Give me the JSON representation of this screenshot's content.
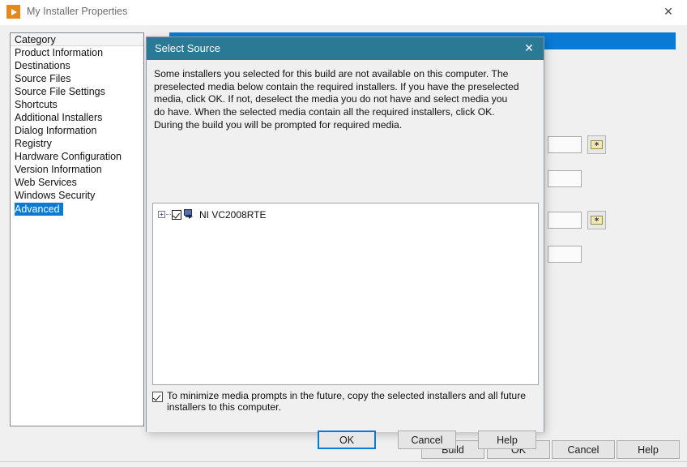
{
  "window": {
    "title": "My Installer Properties",
    "icon": "labview-play-icon",
    "close_label": "✕"
  },
  "sidebar": {
    "header": "Category",
    "items": [
      {
        "label": "Product Information",
        "selected": false
      },
      {
        "label": "Destinations",
        "selected": false
      },
      {
        "label": "Source Files",
        "selected": false
      },
      {
        "label": "Source File Settings",
        "selected": false
      },
      {
        "label": "Shortcuts",
        "selected": false
      },
      {
        "label": "Additional Installers",
        "selected": false
      },
      {
        "label": "Dialog Information",
        "selected": false
      },
      {
        "label": "Registry",
        "selected": false
      },
      {
        "label": "Hardware Configuration",
        "selected": false
      },
      {
        "label": "Version Information",
        "selected": false
      },
      {
        "label": "Web Services",
        "selected": false
      },
      {
        "label": "Windows Security",
        "selected": false
      },
      {
        "label": "Advanced",
        "selected": true
      }
    ]
  },
  "main_buttons": [
    {
      "label": "Build"
    },
    {
      "label": "OK"
    },
    {
      "label": "Cancel"
    },
    {
      "label": "Help"
    }
  ],
  "dialog": {
    "title": "Select Source",
    "close_label": "✕",
    "body_text": "Some installers you selected for this build are not available on this computer. The preselected media below contain the required installers. If you have the preselected media, click OK. If not, deselect the media you do not have and select media you do have. When the selected media contain all the required installers, click OK. During the build you will be prompted for required media.",
    "tree": {
      "expander_label": "+",
      "items": [
        {
          "label": "NI VC2008RTE",
          "checked": true,
          "icon": "media-source-icon"
        }
      ]
    },
    "minimize_prompts": {
      "checked": true,
      "label": "To minimize media prompts in the future, copy the selected installers and all future installers to this computer."
    },
    "buttons": [
      {
        "label": "OK",
        "default": true
      },
      {
        "label": "Cancel",
        "default": false
      },
      {
        "label": "Help",
        "default": false
      }
    ]
  },
  "colors": {
    "selection_blue": "#0a7ad4",
    "dialog_titlebar": "#2a7a96",
    "window_bg": "#f0f0f0"
  }
}
